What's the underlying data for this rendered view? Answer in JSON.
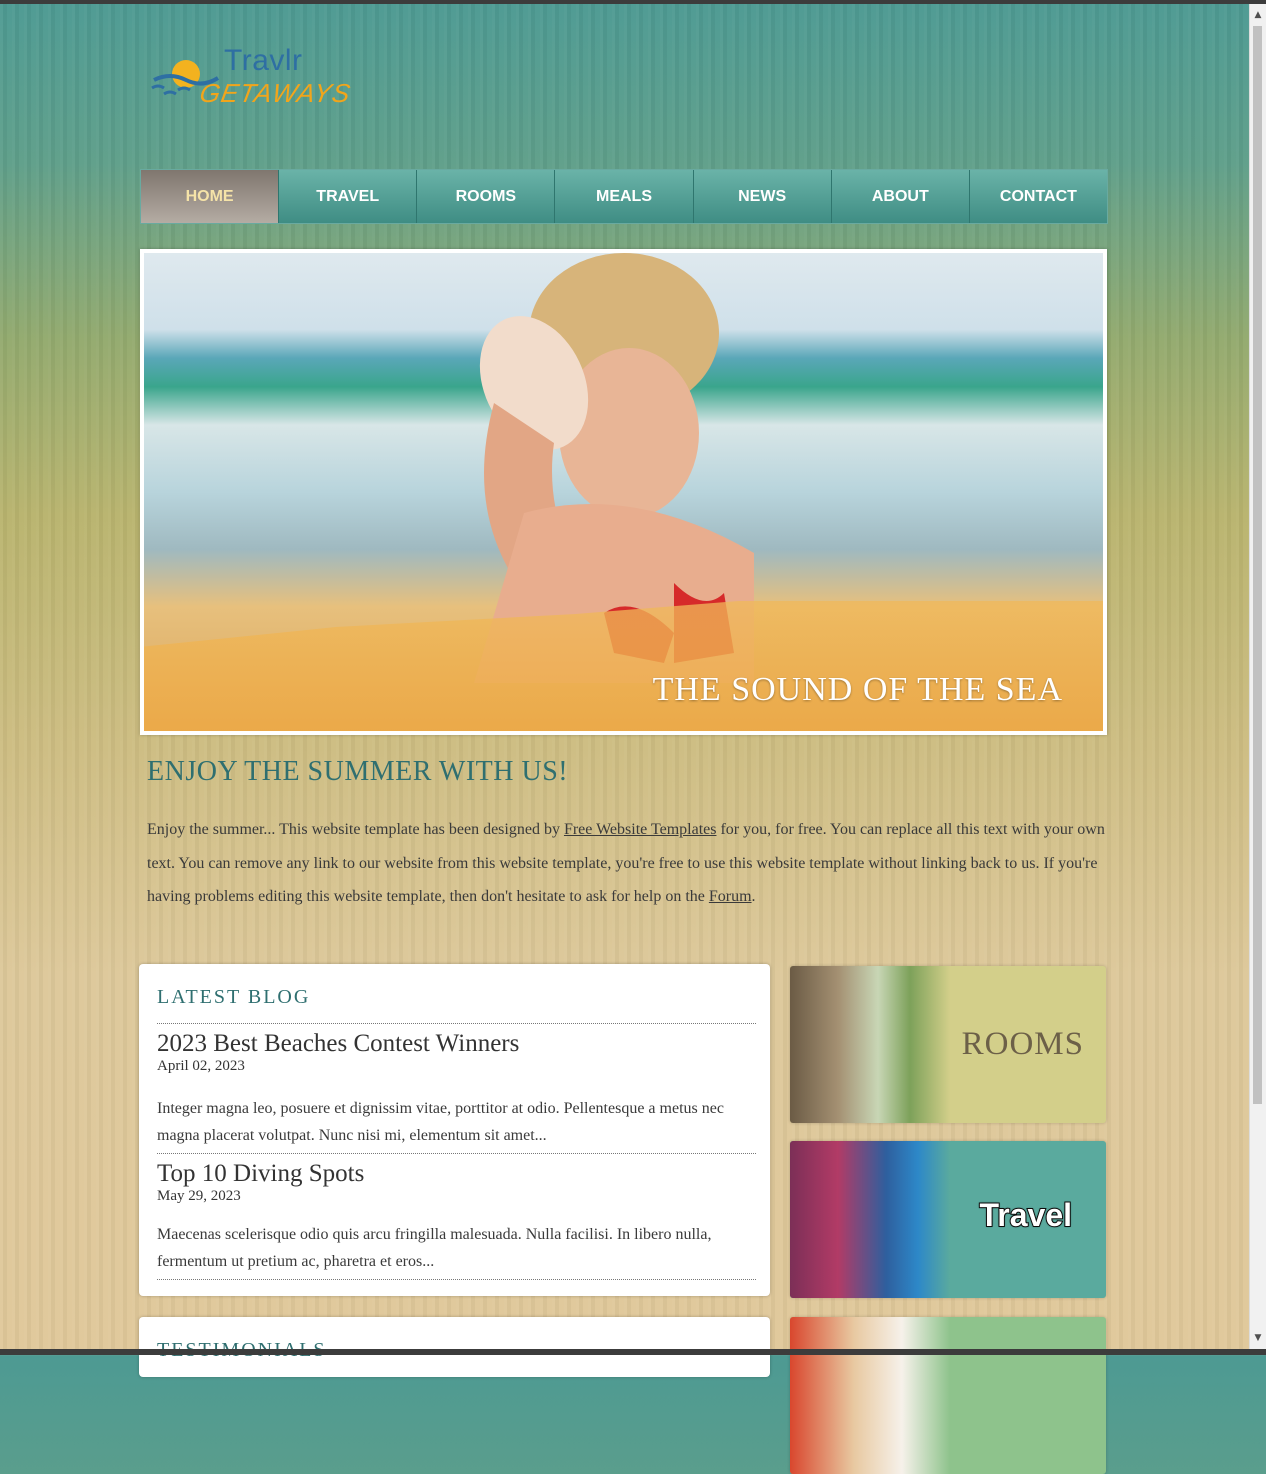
{
  "logo": {
    "title": "Travlr",
    "subtitle": "GETAWAYS"
  },
  "nav": {
    "items": [
      {
        "label": "HOME",
        "active": true
      },
      {
        "label": "TRAVEL"
      },
      {
        "label": "ROOMS"
      },
      {
        "label": "MEALS"
      },
      {
        "label": "NEWS"
      },
      {
        "label": "ABOUT"
      },
      {
        "label": "CONTACT"
      }
    ]
  },
  "hero": {
    "caption": "THE SOUND OF THE SEA"
  },
  "intro": {
    "title": "ENJOY THE SUMMER WITH US!",
    "text_1": "Enjoy the summer... This website template has been designed by ",
    "link_1": "Free Website Templates",
    "text_2": " for you, for free. You can replace all this text with your own text. You can remove any link to our website from this website template, you're free to use this website template without linking back to us. If you're having problems editing this website template, then don't hesitate to ask for help on the ",
    "link_2": "Forum",
    "text_3": "."
  },
  "blog": {
    "title": "LATEST BLOG",
    "posts": [
      {
        "title": "2023 Best Beaches Contest Winners",
        "date": "April 02, 2023",
        "excerpt": "Integer magna leo, posuere et dignissim vitae, porttitor at odio. Pellentesque a metus nec magna placerat volutpat. Nunc nisi mi, elementum sit amet..."
      },
      {
        "title": "Top 10 Diving Spots",
        "date": "May 29, 2023",
        "excerpt": "Maecenas scelerisque odio quis arcu fringilla malesuada. Nulla facilisi. In libero nulla, fermentum ut pretium ac, pharetra et eros..."
      }
    ]
  },
  "testimonials": {
    "title": "TESTIMONIALS"
  },
  "tiles": {
    "rooms": {
      "label": "ROOMS"
    },
    "travel": {
      "label": "Travel"
    }
  },
  "colors": {
    "accent_teal": "#4f9f95",
    "heading": "#2f6f70",
    "nav_active_text": "#f5e3a8"
  }
}
